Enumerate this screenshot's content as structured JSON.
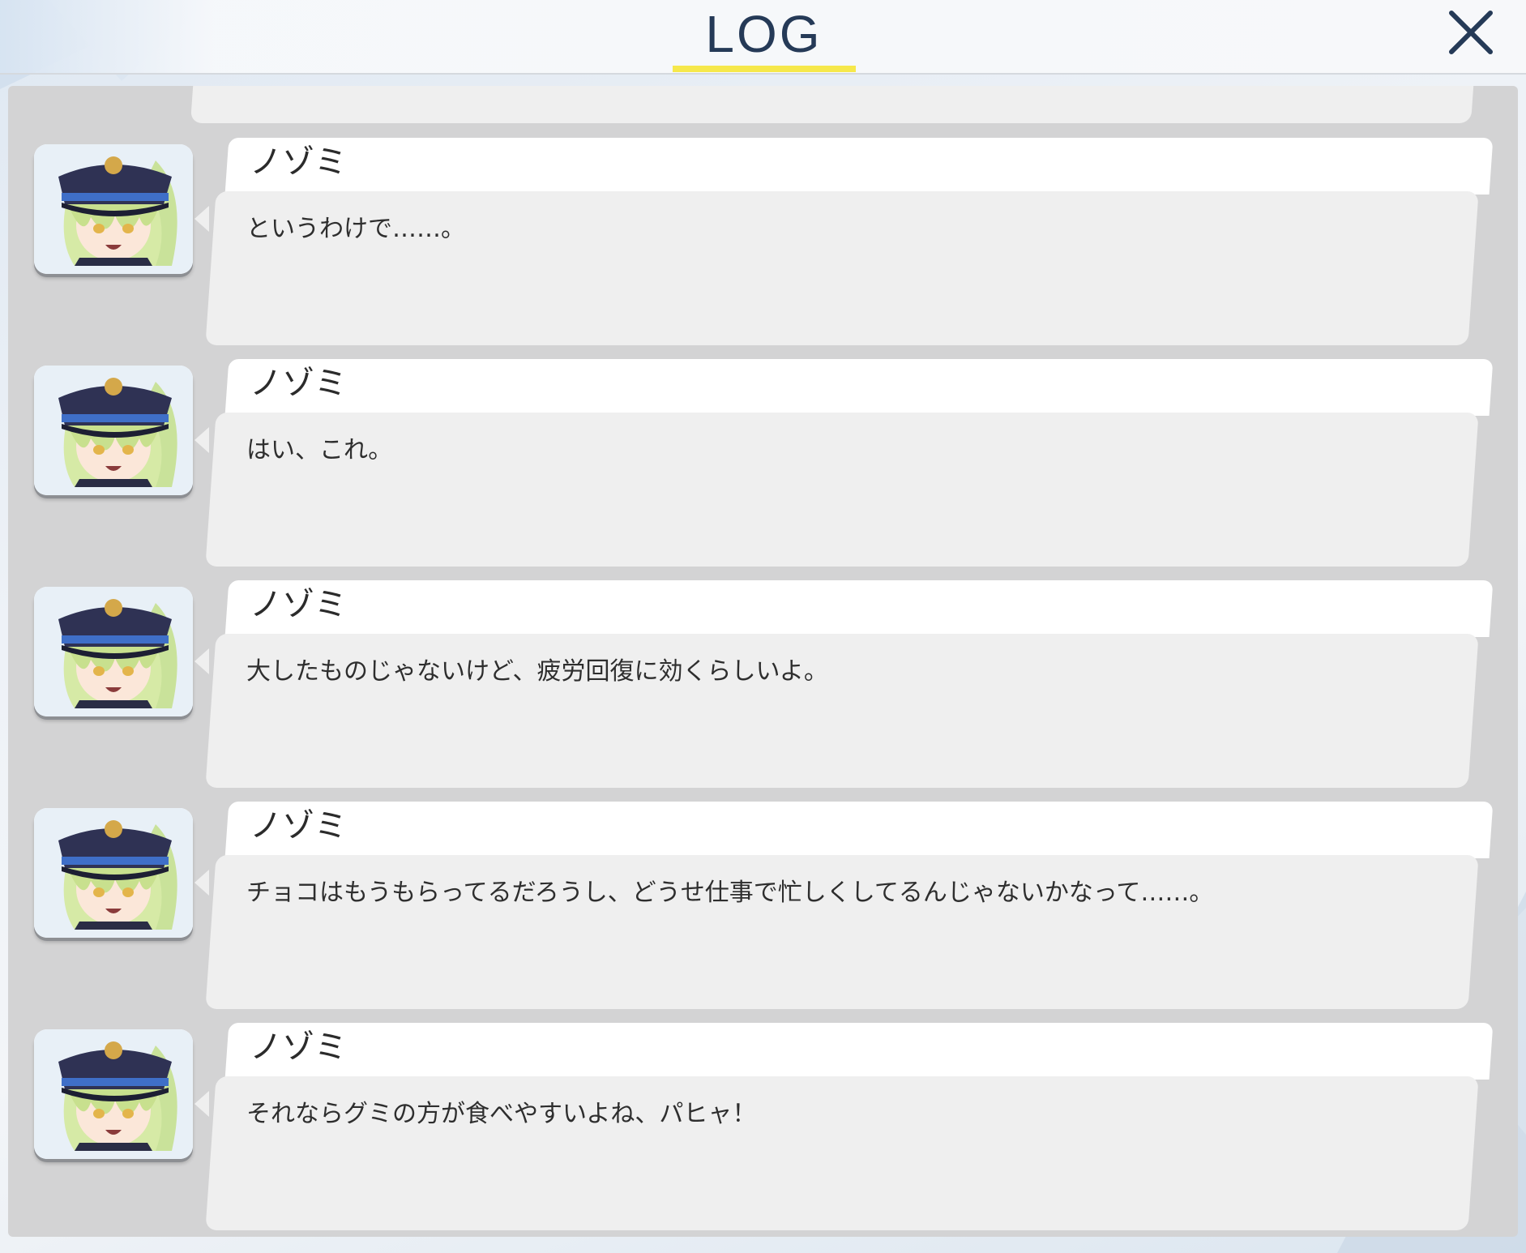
{
  "header": {
    "title": "LOG",
    "accent_color": "#f6e84b",
    "title_color": "#253a57",
    "close_icon": "close-icon"
  },
  "log": {
    "entries": [
      {
        "speaker": "ノゾミ",
        "text": "というわけで……。",
        "avatar": "nozomi-portrait"
      },
      {
        "speaker": "ノゾミ",
        "text": "はい、これ。",
        "avatar": "nozomi-portrait"
      },
      {
        "speaker": "ノゾミ",
        "text": "大したものじゃないけど、疲労回復に効くらしいよ。",
        "avatar": "nozomi-portrait"
      },
      {
        "speaker": "ノゾミ",
        "text": "チョコはもうもらってるだろうし、どうせ仕事で忙しくしてるんじゃないかなって……。",
        "avatar": "nozomi-portrait"
      },
      {
        "speaker": "ノゾミ",
        "text": "それならグミの方が食べやすいよね、パヒャ！",
        "avatar": "nozomi-portrait"
      }
    ]
  }
}
